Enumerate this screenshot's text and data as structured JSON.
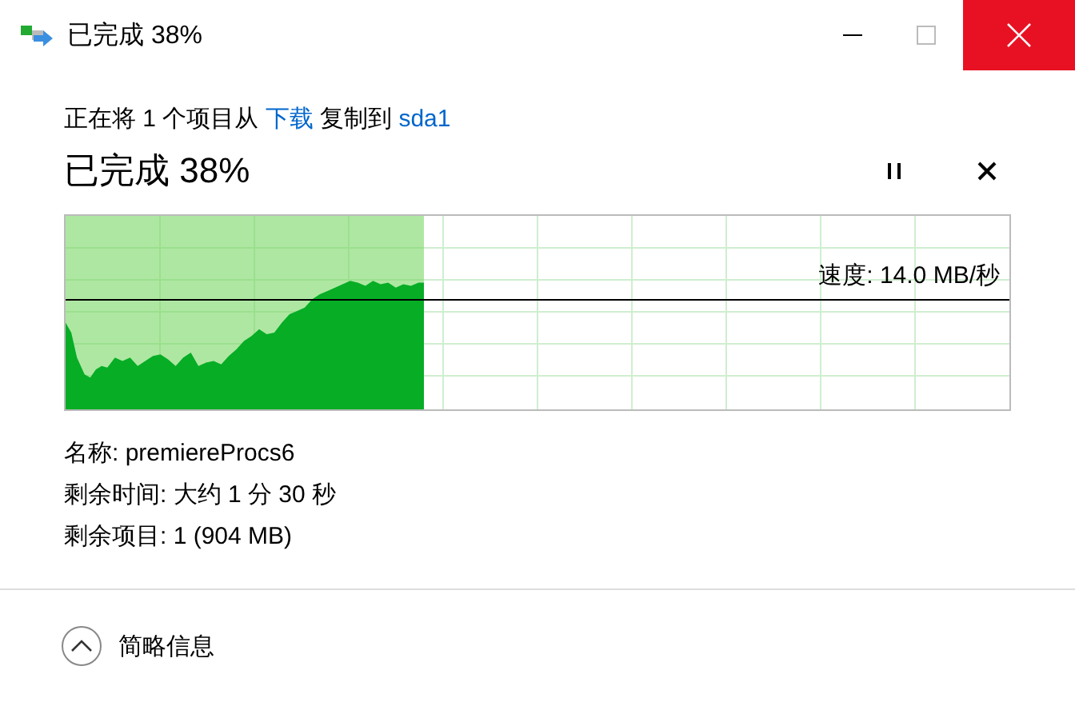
{
  "window": {
    "title": "已完成 38%"
  },
  "copy_line": [
    {
      "kind": "text",
      "text": "正在将 1 个项目从 "
    },
    {
      "kind": "link",
      "text": "下载"
    },
    {
      "kind": "text",
      "text": " 复制到 "
    },
    {
      "kind": "link",
      "text": "sda1"
    }
  ],
  "heading": "已完成 38%",
  "progress": {
    "level": 0.38,
    "speed": "速度: 14.0 MB/秒"
  },
  "details": [
    "名称: premiereProcs6",
    "剩余时间: 大约 1 分 30 秒",
    "剩余项目: 1 (904 MB)"
  ],
  "footer": {
    "toggle": "简略信息"
  }
}
